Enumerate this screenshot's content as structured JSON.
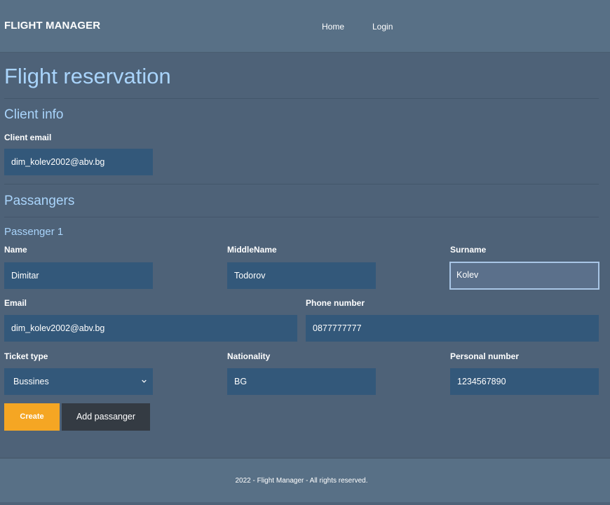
{
  "navbar": {
    "brand": "FLIGHT MANAGER",
    "links": [
      {
        "label": "Home"
      },
      {
        "label": "Login"
      }
    ]
  },
  "page": {
    "title": "Flight reservation"
  },
  "client_info": {
    "heading": "Client info",
    "email_label": "Client email",
    "email_value": "dim_kolev2002@abv.bg"
  },
  "passengers": {
    "heading": "Passangers",
    "items": [
      {
        "heading": "Passenger 1",
        "name_label": "Name",
        "name_value": "Dimitar",
        "middle_label": "MiddleName",
        "middle_value": "Todorov",
        "surname_label": "Surname",
        "surname_value": "Kolev",
        "email_label": "Email",
        "email_value": "dim_kolev2002@abv.bg",
        "phone_label": "Phone number",
        "phone_value": "0877777777",
        "ticket_label": "Ticket type",
        "ticket_value": "Bussines",
        "nationality_label": "Nationality",
        "nationality_value": "BG",
        "personal_label": "Personal number",
        "personal_value": "1234567890"
      }
    ]
  },
  "actions": {
    "create_label": "Create",
    "add_label": "Add passanger"
  },
  "footer": {
    "text": "2022 - Flight Manager - All rights reserved."
  },
  "colors": {
    "accent": "#a9d4fb",
    "create_button": "#f5a623",
    "input_bg": "#33587a"
  }
}
